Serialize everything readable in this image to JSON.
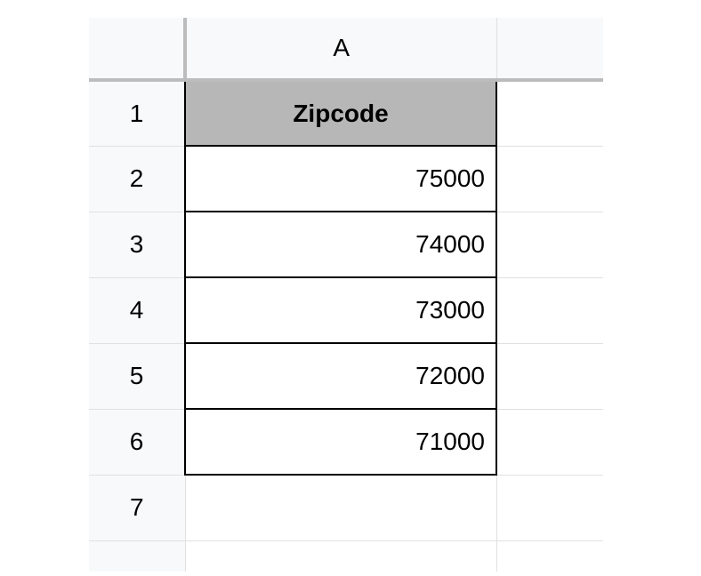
{
  "columns": {
    "A": "A"
  },
  "row_numbers": [
    "1",
    "2",
    "3",
    "4",
    "5",
    "6",
    "7"
  ],
  "table": {
    "header": "Zipcode",
    "rows": [
      "75000",
      "74000",
      "73000",
      "72000",
      "71000"
    ]
  }
}
